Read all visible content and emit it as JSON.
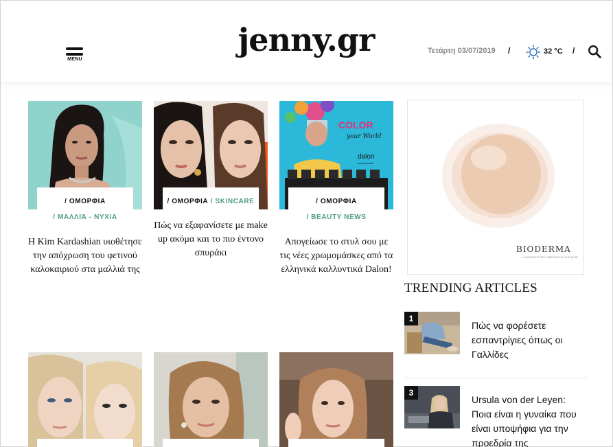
{
  "header": {
    "menu_label": "MENU",
    "logo": "jenny.gr",
    "date": "Τετάρτη 03/07/2019",
    "separator": "/",
    "temperature": "32 °C",
    "weather_icon": "sun-icon",
    "search_icon": "search-icon"
  },
  "articles": [
    {
      "category": "/ ΟΜΟΡΦΙΑ",
      "subcategory": "/ ΜΑΛΛΙΆ - ΝΥΧΙΑ",
      "title": "Η Kim Kardashian υιοθέτησε την απόχρωση του φετινού καλοκαιριού στα μαλλιά της"
    },
    {
      "category": "/ ΟΜΟΡΦΙΑ",
      "secondary": "/ SKINCARE",
      "title": "Πώς να εξαφανίσετε με make up ακόμα και το πιο έντονο σπυράκι"
    },
    {
      "category": "/ ΟΜΟΡΦΙΑ",
      "subcategory": "/ BEAUTY NEWS",
      "title": "Απογείωσε το στυλ σου με τις νέες χρωμομάσκες από τα ελληνικά καλλυντικά Dalon!",
      "image_text": {
        "headline": "COLOR",
        "tagline": "your World",
        "brand": "dalon",
        "brand_sub": "carecosmetic"
      }
    },
    {
      "category": ""
    },
    {
      "category": ""
    },
    {
      "category": ""
    }
  ],
  "ad": {
    "brand": "BIODERMA",
    "brand_sub": "LABORATOIRE DERMATOLOGIQUE"
  },
  "trending": {
    "title": "TRENDING ARTICLES",
    "items": [
      {
        "rank": "1",
        "title": "Πώς να φορέσετε εσπαντρίγιες όπως οι Γαλλίδες"
      },
      {
        "rank": "3",
        "title": "Ursula von der Leyen: Ποια είναι η γυναίκα που είναι υποψήφια για την προεδρία της"
      }
    ]
  },
  "colors": {
    "accent": "#4f9a8a",
    "text": "#111111",
    "date": "#888888"
  }
}
